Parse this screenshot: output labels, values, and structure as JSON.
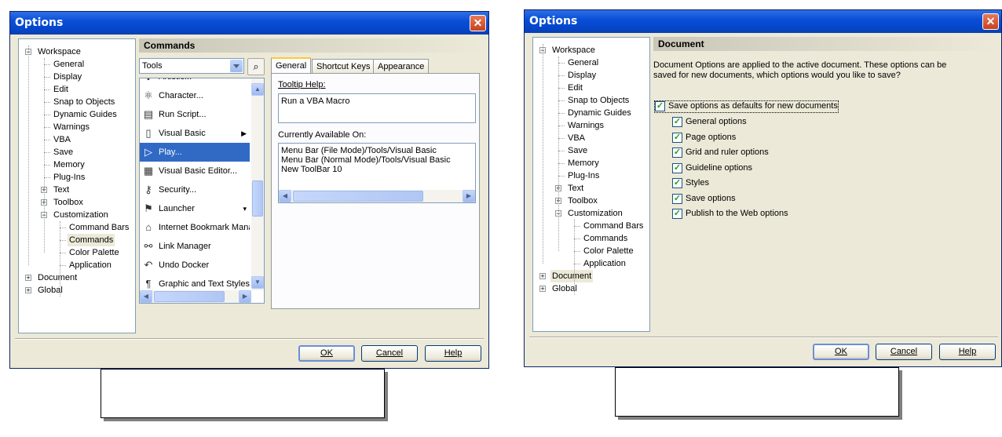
{
  "left": {
    "title": "Options",
    "tree": [
      {
        "label": "Workspace",
        "expander": "−"
      },
      {
        "label": "General"
      },
      {
        "label": "Display"
      },
      {
        "label": "Edit"
      },
      {
        "label": "Snap to Objects"
      },
      {
        "label": "Dynamic Guides"
      },
      {
        "label": "Warnings"
      },
      {
        "label": "VBA"
      },
      {
        "label": "Save"
      },
      {
        "label": "Memory"
      },
      {
        "label": "Plug-Ins"
      },
      {
        "label": "Text",
        "expander": "+"
      },
      {
        "label": "Toolbox",
        "expander": "+"
      },
      {
        "label": "Customization",
        "expander": "−"
      },
      {
        "label": "Command Bars"
      },
      {
        "label": "Commands"
      },
      {
        "label": "Color Palette"
      },
      {
        "label": "Application"
      },
      {
        "label": "Document",
        "expander": "+"
      },
      {
        "label": "Global",
        "expander": "+"
      }
    ],
    "header": "Commands",
    "category_combo": "Tools",
    "command_list": [
      {
        "label": "Artistic...",
        "icon": "dots-icon"
      },
      {
        "label": "Character...",
        "icon": "character-icon"
      },
      {
        "label": "Run Script...",
        "icon": "script-icon"
      },
      {
        "label": "Visual Basic",
        "icon": "page-icon",
        "submenu": "▶"
      },
      {
        "label": "Play...",
        "icon": "play-icon"
      },
      {
        "label": "Visual Basic Editor...",
        "icon": "editor-icon"
      },
      {
        "label": "Security...",
        "icon": "key-icon"
      },
      {
        "label": "Launcher",
        "icon": "launcher-icon",
        "submenu": "▾"
      },
      {
        "label": "Internet Bookmark Manager",
        "icon": "bookmark-icon"
      },
      {
        "label": "Link Manager",
        "icon": "link-icon"
      },
      {
        "label": "Undo Docker",
        "icon": "undo-icon"
      },
      {
        "label": "Graphic and Text Styles",
        "icon": "styles-icon"
      }
    ],
    "tabs": [
      "General",
      "Shortcut Keys",
      "Appearance"
    ],
    "tooltip_label": "Tooltip Help:",
    "tooltip_value": "Run a VBA Macro",
    "available_label": "Currently Available On:",
    "available_lines": [
      "Menu Bar (File Mode)/Tools/Visual Basic",
      "Menu Bar (Normal Mode)/Tools/Visual Basic",
      "New ToolBar 10"
    ],
    "buttons": {
      "ok": "OK",
      "cancel": "Cancel",
      "help": "Help"
    }
  },
  "right": {
    "title": "Options",
    "tree": [
      {
        "label": "Workspace",
        "expander": "−"
      },
      {
        "label": "General"
      },
      {
        "label": "Display"
      },
      {
        "label": "Edit"
      },
      {
        "label": "Snap to Objects"
      },
      {
        "label": "Dynamic Guides"
      },
      {
        "label": "Warnings"
      },
      {
        "label": "VBA"
      },
      {
        "label": "Save"
      },
      {
        "label": "Memory"
      },
      {
        "label": "Plug-Ins"
      },
      {
        "label": "Text",
        "expander": "+"
      },
      {
        "label": "Toolbox",
        "expander": "+"
      },
      {
        "label": "Customization",
        "expander": "−"
      },
      {
        "label": "Command Bars"
      },
      {
        "label": "Commands"
      },
      {
        "label": "Color Palette"
      },
      {
        "label": "Application"
      },
      {
        "label": "Document",
        "expander": "+"
      },
      {
        "label": "Global",
        "expander": "+"
      }
    ],
    "header": "Document",
    "description": "Document Options are applied to the active document. These options can be saved for new documents, which options would you like to save?",
    "master_checkbox": "Save options as defaults for new documents",
    "checkboxes": [
      "General options",
      "Page options",
      "Grid and ruler options",
      "Guideline options",
      "Styles",
      "Save options",
      "Publish to the Web options"
    ],
    "check_mark": "✓",
    "buttons": {
      "ok": "OK",
      "cancel": "Cancel",
      "help": "Help"
    }
  }
}
